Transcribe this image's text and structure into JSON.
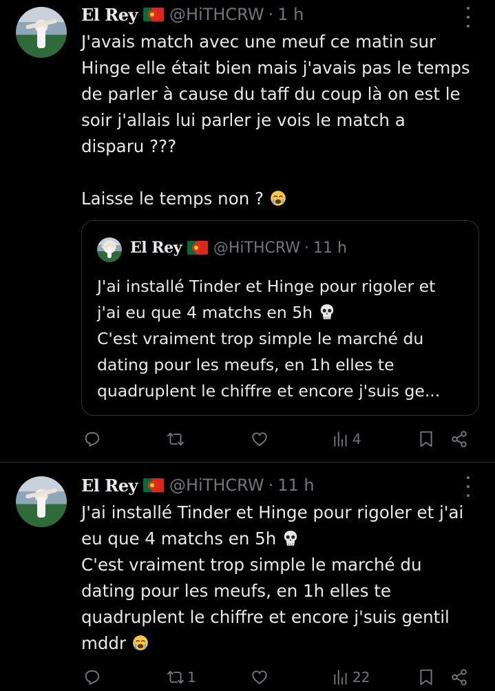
{
  "tweets": [
    {
      "author": {
        "name": "El Rey",
        "flag": "🇵🇹",
        "handle": "@HiTHCRW",
        "separator": "·",
        "time": "1 h"
      },
      "text_lines": [
        "J'avais match avec une meuf ce matin sur",
        "Hinge elle était bien mais j'avais pas le temps",
        "de parler à cause du taff du coup là on est le",
        "soir j'allais lui parler je vois le match a",
        "disparu ???",
        "",
        "Laisse le temps non ?"
      ],
      "trailing_emoji": "crying-face",
      "quote": {
        "author": {
          "name": "El Rey",
          "flag": "🇵🇹",
          "handle": "@HiTHCRW",
          "separator": "·",
          "time": "11 h"
        },
        "text_lines": [
          "J'ai installé Tinder et Hinge pour rigoler et",
          "j'ai eu que 4 matchs en 5h",
          "C'est vraiment trop simple le marché du",
          "dating pour les meufs, en 1h elles te",
          "quadruplent le chiffre et encore j'suis ge..."
        ],
        "emoji": "skull"
      },
      "actions": {
        "reply": "",
        "retweet": "",
        "like": "",
        "views": "4"
      }
    },
    {
      "author": {
        "name": "El Rey",
        "flag": "🇵🇹",
        "handle": "@HiTHCRW",
        "separator": "·",
        "time": "11 h"
      },
      "text_lines": [
        "J'ai installé Tinder et Hinge pour rigoler et j'ai",
        "eu que 4 matchs en 5h",
        "C'est vraiment trop simple le marché du",
        "dating pour les meufs, en 1h elles te",
        "quadruplent le chiffre et encore j'suis gentil",
        "mddr"
      ],
      "emojis": [
        "skull",
        "crying-face"
      ],
      "actions": {
        "reply": "",
        "retweet": "1",
        "like": "",
        "views": "22"
      }
    }
  ],
  "colors": {
    "background": "#000000",
    "text": "#e7e9ea",
    "muted": "#71767b",
    "border": "#2f3336"
  }
}
